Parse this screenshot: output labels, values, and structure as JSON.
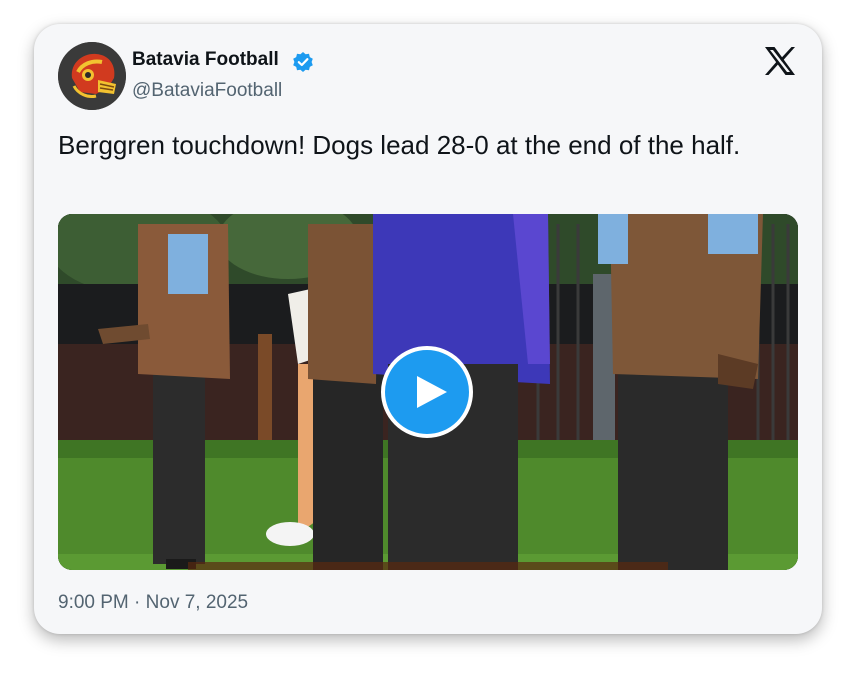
{
  "tweet": {
    "author": {
      "display_name": "Batavia Football",
      "handle": "@BataviaFootball",
      "verified": true,
      "avatar_icon": "helmet-logo-icon"
    },
    "text": "Berggren touchdown! Dogs lead 28-0 at the end of the half.",
    "media": {
      "type": "video",
      "play_icon": "play-icon"
    },
    "time": "9:00 PM",
    "separator": "·",
    "date": "Nov 7, 2025"
  },
  "brand": {
    "logo_icon": "x-logo-icon"
  },
  "colors": {
    "card_background": "#f6f7f9",
    "text_primary": "#0f1419",
    "text_secondary": "#536471",
    "accent_blue": "#1d9bf0"
  }
}
